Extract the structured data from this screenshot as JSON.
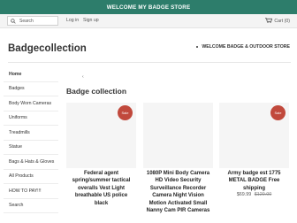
{
  "announcement": "WELCOME MY BADGE STORE",
  "topbar": {
    "search_placeholder": "Search",
    "login_label": "Log in",
    "signup_label": "Sign up",
    "cart_label": "Cart (0)"
  },
  "header": {
    "brand": "Badgecollection",
    "nav_link": "WELCOME BADGE & OUTDOOR STORE"
  },
  "sidebar": {
    "items": [
      {
        "label": "Home"
      },
      {
        "label": "Badges"
      },
      {
        "label": "Body Worn Cameras"
      },
      {
        "label": "Uniforms"
      },
      {
        "label": "Treadmills"
      },
      {
        "label": "Statue"
      },
      {
        "label": "Bags & Hats & Gloves"
      },
      {
        "label": "All Products"
      },
      {
        "label": "HOW TO PAY!!!"
      },
      {
        "label": "Search"
      }
    ]
  },
  "main": {
    "breadcrumb_arrow": "‹",
    "title": "Badge collection",
    "products": [
      {
        "title": "Federal agent spring/summer tactical overalls Vest Light breathable US police black",
        "badge": "Sale",
        "price": "",
        "old_price": ""
      },
      {
        "title": "1080P Mini Body Camera HD Video Security Surveillance Recorder Camera Night Vision Motion Activated Small Nanny Cam PIR Cameras",
        "badge": "",
        "price": "",
        "old_price": ""
      },
      {
        "title": "Army badge est 1775 METAL BADGE Free shipping",
        "badge": "Sale",
        "price": "$69.99",
        "old_price": "$120.00"
      }
    ]
  },
  "colors": {
    "accent": "#2d7d6b",
    "sale_badge": "#c1493c"
  },
  "icons": {
    "search": "search-icon",
    "cart": "cart-icon"
  }
}
